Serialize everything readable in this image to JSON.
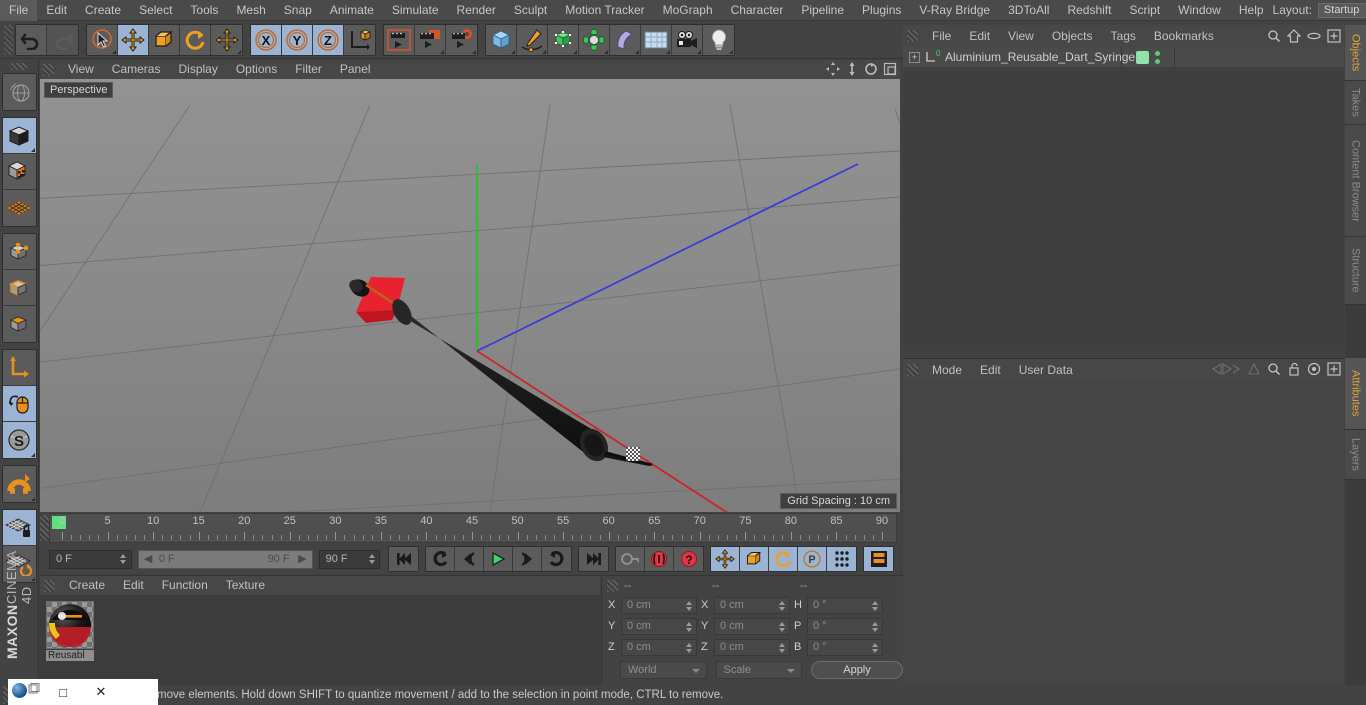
{
  "app": {
    "brand_top": "MAXON",
    "brand_bottom": "CINEMA 4D"
  },
  "menubar": {
    "items": [
      "File",
      "Edit",
      "Create",
      "Select",
      "Tools",
      "Mesh",
      "Snap",
      "Animate",
      "Simulate",
      "Render",
      "Sculpt",
      "Motion Tracker",
      "MoGraph",
      "Character",
      "Pipeline",
      "Plugins",
      "V-Ray Bridge",
      "3DToAll",
      "Redshift",
      "Script",
      "Window",
      "Help"
    ],
    "layout_label": "Layout:",
    "layout_value": "Startup",
    "search_icon": "search-icon"
  },
  "toolbar": {
    "groups": [
      {
        "name": "undo-redo",
        "buttons": [
          {
            "name": "undo-button",
            "icon": "undo-icon",
            "selected": false,
            "disabled": false
          },
          {
            "name": "redo-button",
            "icon": "redo-icon",
            "selected": false,
            "disabled": true
          }
        ]
      },
      {
        "name": "tools",
        "buttons": [
          {
            "name": "live-selection-button",
            "icon": "cursor-select-icon",
            "selected": false,
            "disabled": false
          },
          {
            "name": "move-button",
            "icon": "move-icon",
            "selected": true,
            "disabled": false
          },
          {
            "name": "scale-button",
            "icon": "scale-icon",
            "selected": false,
            "disabled": false
          },
          {
            "name": "rotate-button",
            "icon": "rotate-icon",
            "selected": false,
            "disabled": false
          },
          {
            "name": "transform-button",
            "icon": "move-icon",
            "selected": false,
            "disabled": false
          }
        ]
      },
      {
        "name": "axis-locks",
        "buttons": [
          {
            "name": "x-axis-lock-button",
            "icon": "x-axis-icon",
            "selected": true,
            "disabled": false
          },
          {
            "name": "y-axis-lock-button",
            "icon": "y-axis-icon",
            "selected": true,
            "disabled": false
          },
          {
            "name": "z-axis-lock-button",
            "icon": "z-axis-icon",
            "selected": true,
            "disabled": false
          },
          {
            "name": "world-object-axis-button",
            "icon": "world-axis-icon",
            "selected": false,
            "disabled": false
          }
        ]
      },
      {
        "name": "render",
        "buttons": [
          {
            "name": "render-view-button",
            "icon": "render-view-icon",
            "selected": false,
            "disabled": false
          },
          {
            "name": "render-to-picture-viewer-button",
            "icon": "render-picture-icon",
            "selected": false,
            "disabled": false
          },
          {
            "name": "render-settings-button",
            "icon": "render-settings-icon",
            "selected": false,
            "disabled": false
          }
        ]
      },
      {
        "name": "create",
        "buttons": [
          {
            "name": "add-cube-button",
            "icon": "cube-icon",
            "selected": false,
            "disabled": false
          },
          {
            "name": "add-spline-button",
            "icon": "pen-spline-icon",
            "selected": false,
            "disabled": false
          },
          {
            "name": "add-generator-button",
            "icon": "generator-icon",
            "selected": false,
            "disabled": false
          },
          {
            "name": "add-deformer-button",
            "icon": "deformer-icon",
            "selected": false,
            "disabled": false
          },
          {
            "name": "add-bend-button",
            "icon": "bend-icon",
            "selected": false,
            "disabled": false
          },
          {
            "name": "add-floor-button",
            "icon": "floor-grid-icon",
            "selected": false,
            "disabled": false
          },
          {
            "name": "add-camera-button",
            "icon": "camera-icon",
            "selected": false,
            "disabled": false
          },
          {
            "name": "add-light-button",
            "icon": "light-bulb-icon",
            "selected": false,
            "disabled": false
          }
        ]
      }
    ]
  },
  "left_toolbar": {
    "groups": [
      {
        "buttons": [
          {
            "name": "undo-view-button",
            "icon": "globe-wireframe-icon",
            "selected": false
          }
        ]
      },
      {
        "buttons": [
          {
            "name": "object-mode-button",
            "icon": "object-cube-icon",
            "selected": true
          },
          {
            "name": "texture-mode-button",
            "icon": "texture-checker-icon",
            "selected": false
          },
          {
            "name": "workplane-mode-button",
            "icon": "workplane-icon",
            "selected": false
          }
        ]
      },
      {
        "buttons": [
          {
            "name": "points-mode-button",
            "icon": "points-cube-icon",
            "selected": false
          },
          {
            "name": "edges-mode-button",
            "icon": "edges-cube-icon",
            "selected": false
          },
          {
            "name": "polygons-mode-button",
            "icon": "polygons-cube-icon",
            "selected": false
          }
        ]
      },
      {
        "buttons": [
          {
            "name": "axis-modify-button",
            "icon": "axis-l-icon",
            "selected": false
          },
          {
            "name": "enable-axis-button",
            "icon": "mouse-axis-icon",
            "selected": true
          },
          {
            "name": "soft-selection-button",
            "icon": "s-sphere-icon",
            "selected": true
          }
        ]
      },
      {
        "buttons": [
          {
            "name": "snap-magnet-button",
            "icon": "magnet-icon",
            "selected": false
          }
        ]
      },
      {
        "buttons": [
          {
            "name": "lock-workplane-button",
            "icon": "workplane-lock-icon",
            "selected": true
          },
          {
            "name": "planar-workplane-button",
            "icon": "workplane-rotate-icon",
            "selected": false
          }
        ]
      }
    ]
  },
  "viewport": {
    "menus": [
      "View",
      "Cameras",
      "Display",
      "Options",
      "Filter",
      "Panel"
    ],
    "label": "Perspective",
    "grid_spacing": "Grid Spacing : 10 cm",
    "axis_gizmo": {
      "y": "Y",
      "z": "Z",
      "x": "X"
    },
    "corner_icons": [
      "pan-icon",
      "dolly-icon",
      "rotate-view-icon",
      "maximize-view-icon"
    ],
    "colors": {
      "y_axis": "#2bd22b",
      "z_axis": "#4646e6",
      "x_axis": "#e02020",
      "object_body": "#1c1c1c",
      "object_accent": "#e8222e"
    }
  },
  "timeline": {
    "tick_labels": [
      "0",
      "5",
      "10",
      "15",
      "20",
      "25",
      "30",
      "35",
      "40",
      "45",
      "50",
      "55",
      "60",
      "65",
      "70",
      "75",
      "80",
      "85",
      "90"
    ],
    "current_frame_marker": "0",
    "left_field": "0 F",
    "preview_min": "0 F",
    "preview_max": "90 F",
    "right_field": "90 F",
    "end_field": "0 F",
    "buttons": [
      {
        "name": "go-to-start-button",
        "icon": "skip-start-icon",
        "selected": false
      },
      {
        "name": "go-to-previous-key-button",
        "icon": "prev-key-icon",
        "selected": false
      },
      {
        "name": "step-back-button",
        "icon": "step-back-icon",
        "selected": false
      },
      {
        "name": "play-button",
        "icon": "play-icon",
        "selected": false
      },
      {
        "name": "step-forward-button",
        "icon": "step-forward-icon",
        "selected": false
      },
      {
        "name": "go-to-next-key-button",
        "icon": "next-key-icon",
        "selected": false
      },
      {
        "name": "go-to-end-button",
        "icon": "skip-end-icon",
        "selected": false
      },
      {
        "name": "record-active-objects-button",
        "icon": "key-icon",
        "selected": false
      },
      {
        "name": "autokeying-button",
        "icon": "autokey-icon",
        "selected": false
      },
      {
        "name": "keyframe-selection-button",
        "icon": "question-key-icon",
        "selected": false
      },
      {
        "name": "position-key-button",
        "icon": "move-icon",
        "selected": true
      },
      {
        "name": "scale-key-button",
        "icon": "scale-icon",
        "selected": true
      },
      {
        "name": "rotation-key-button",
        "icon": "rotate-icon",
        "selected": true
      },
      {
        "name": "parameter-key-button",
        "icon": "p-circle-icon",
        "selected": true
      },
      {
        "name": "point-level-animation-button",
        "icon": "pla-dots-icon",
        "selected": true
      },
      {
        "name": "timeline-view-button",
        "icon": "film-strip-icon",
        "selected": true
      }
    ]
  },
  "material_manager": {
    "menus": [
      "Create",
      "Edit",
      "Function",
      "Texture"
    ],
    "materials": [
      {
        "name": "Reusabl",
        "preview": "material-sphere-preview"
      }
    ]
  },
  "coordinates": {
    "header_dashes": [
      "--",
      "--",
      "--"
    ],
    "rows": [
      {
        "pos_label": "X",
        "pos_value": "0 cm",
        "size_label": "X",
        "size_value": "0 cm",
        "rot_label": "H",
        "rot_value": "0 °"
      },
      {
        "pos_label": "Y",
        "pos_value": "0 cm",
        "size_label": "Y",
        "size_value": "0 cm",
        "rot_label": "P",
        "rot_value": "0 °"
      },
      {
        "pos_label": "Z",
        "pos_value": "0 cm",
        "size_label": "Z",
        "size_value": "0 cm",
        "rot_label": "B",
        "rot_value": "0 °"
      }
    ],
    "coord_system": "World",
    "transform_mode": "Scale",
    "apply_label": "Apply"
  },
  "objects_panel": {
    "menus": [
      "File",
      "Edit",
      "View",
      "Objects",
      "Tags",
      "Bookmarks"
    ],
    "icons": [
      "search-icon",
      "home-icon",
      "ellipse-icon",
      "plus-box-icon"
    ],
    "rows": [
      {
        "name": "Aluminium_Reusable_Dart_Syringe",
        "expand": "+",
        "tag_color": "#8fe3a6"
      }
    ]
  },
  "attributes_panel": {
    "menus": [
      "Mode",
      "Edit",
      "User Data"
    ],
    "icons": [
      "nav-back-icon",
      "nav-up-icon",
      "search-icon",
      "lock-open-icon",
      "target-icon",
      "plus-box-icon"
    ]
  },
  "vertical_tabs": {
    "top": [
      {
        "label": "Objects",
        "active": true
      },
      {
        "label": "Takes",
        "active": false
      },
      {
        "label": "Content Browser",
        "active": false
      },
      {
        "label": "Structure",
        "active": false
      }
    ],
    "bottom": [
      {
        "label": "Attributes",
        "active": true
      },
      {
        "label": "Layers",
        "active": false
      }
    ]
  },
  "statusbar": {
    "text": "move elements. Hold down SHIFT to quantize movement / add to the selection in point mode, CTRL to remove."
  },
  "taskbar": {
    "app_icon": "blue-sphere-icon",
    "restore_label": "□",
    "close_label": "✕"
  }
}
